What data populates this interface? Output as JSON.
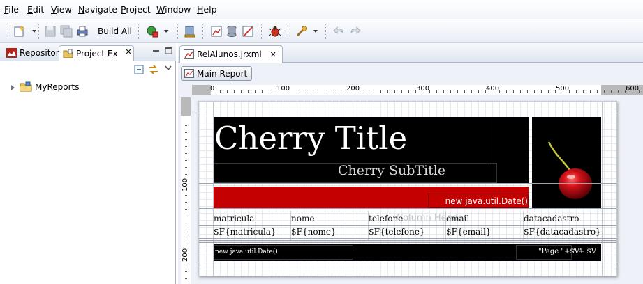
{
  "menu": [
    {
      "label": "File",
      "mnemonic": "F",
      "rest": "ile"
    },
    {
      "label": "Edit",
      "mnemonic": "E",
      "rest": "dit"
    },
    {
      "label": "View",
      "mnemonic": "V",
      "rest": "iew"
    },
    {
      "label": "Navigate",
      "mnemonic": "N",
      "rest": "avigate"
    },
    {
      "label": "Project",
      "mnemonic": "P",
      "rest": "roject"
    },
    {
      "label": "Window",
      "mnemonic": "W",
      "rest": "indow"
    },
    {
      "label": "Help",
      "mnemonic": "H",
      "rest": "elp"
    }
  ],
  "toolbar": {
    "build_all_label": "Build All",
    "icons": [
      "new-wizard-icon",
      "save-icon",
      "save-all-icon",
      "print-icon",
      "run-icon",
      "deploy-icon",
      "report-icon",
      "database-icon",
      "chart-edit-icon",
      "debug-icon",
      "tools-icon",
      "back-icon",
      "forward-icon"
    ]
  },
  "left_pane": {
    "tabs": [
      {
        "label": "Repositor",
        "icon": "repository-icon",
        "active": false
      },
      {
        "label": "Project Ex",
        "icon": "project-explorer-icon",
        "active": true
      }
    ],
    "tree": [
      {
        "label": "MyReports",
        "icon": "folder-icon",
        "expanded": false
      }
    ]
  },
  "editor": {
    "tab_label": "RelAlunos.jrxml",
    "report_button_label": "Main Report",
    "ruler_h_labels": [
      "0",
      "100",
      "200",
      "300",
      "400",
      "500",
      "600"
    ],
    "ruler_v_labels": [
      "100",
      "200"
    ]
  },
  "report": {
    "title": "Cherry Title",
    "subtitle": "Cherry SubTitle",
    "date_expr": "new java.util.Date()",
    "band_watermark": "Column Header",
    "columns": [
      {
        "header": "matricula",
        "field": "$F{matricula}"
      },
      {
        "header": "nome",
        "field": "$F{nome}"
      },
      {
        "header": "telefone",
        "field": "$F{telefone}"
      },
      {
        "header": "email",
        "field": "$F{email}"
      },
      {
        "header": "datacadastro",
        "field": "$F{datacadastro}"
      }
    ],
    "footer_date": "new java.util.Date()",
    "footer_page": "\"Page \"+$V\"",
    "footer_page2": "\" + $V"
  },
  "colors": {
    "title_band": "#000000",
    "red_bar": "#c40000",
    "cherry": "#d4121a",
    "selection_blue": "#3875d7"
  }
}
